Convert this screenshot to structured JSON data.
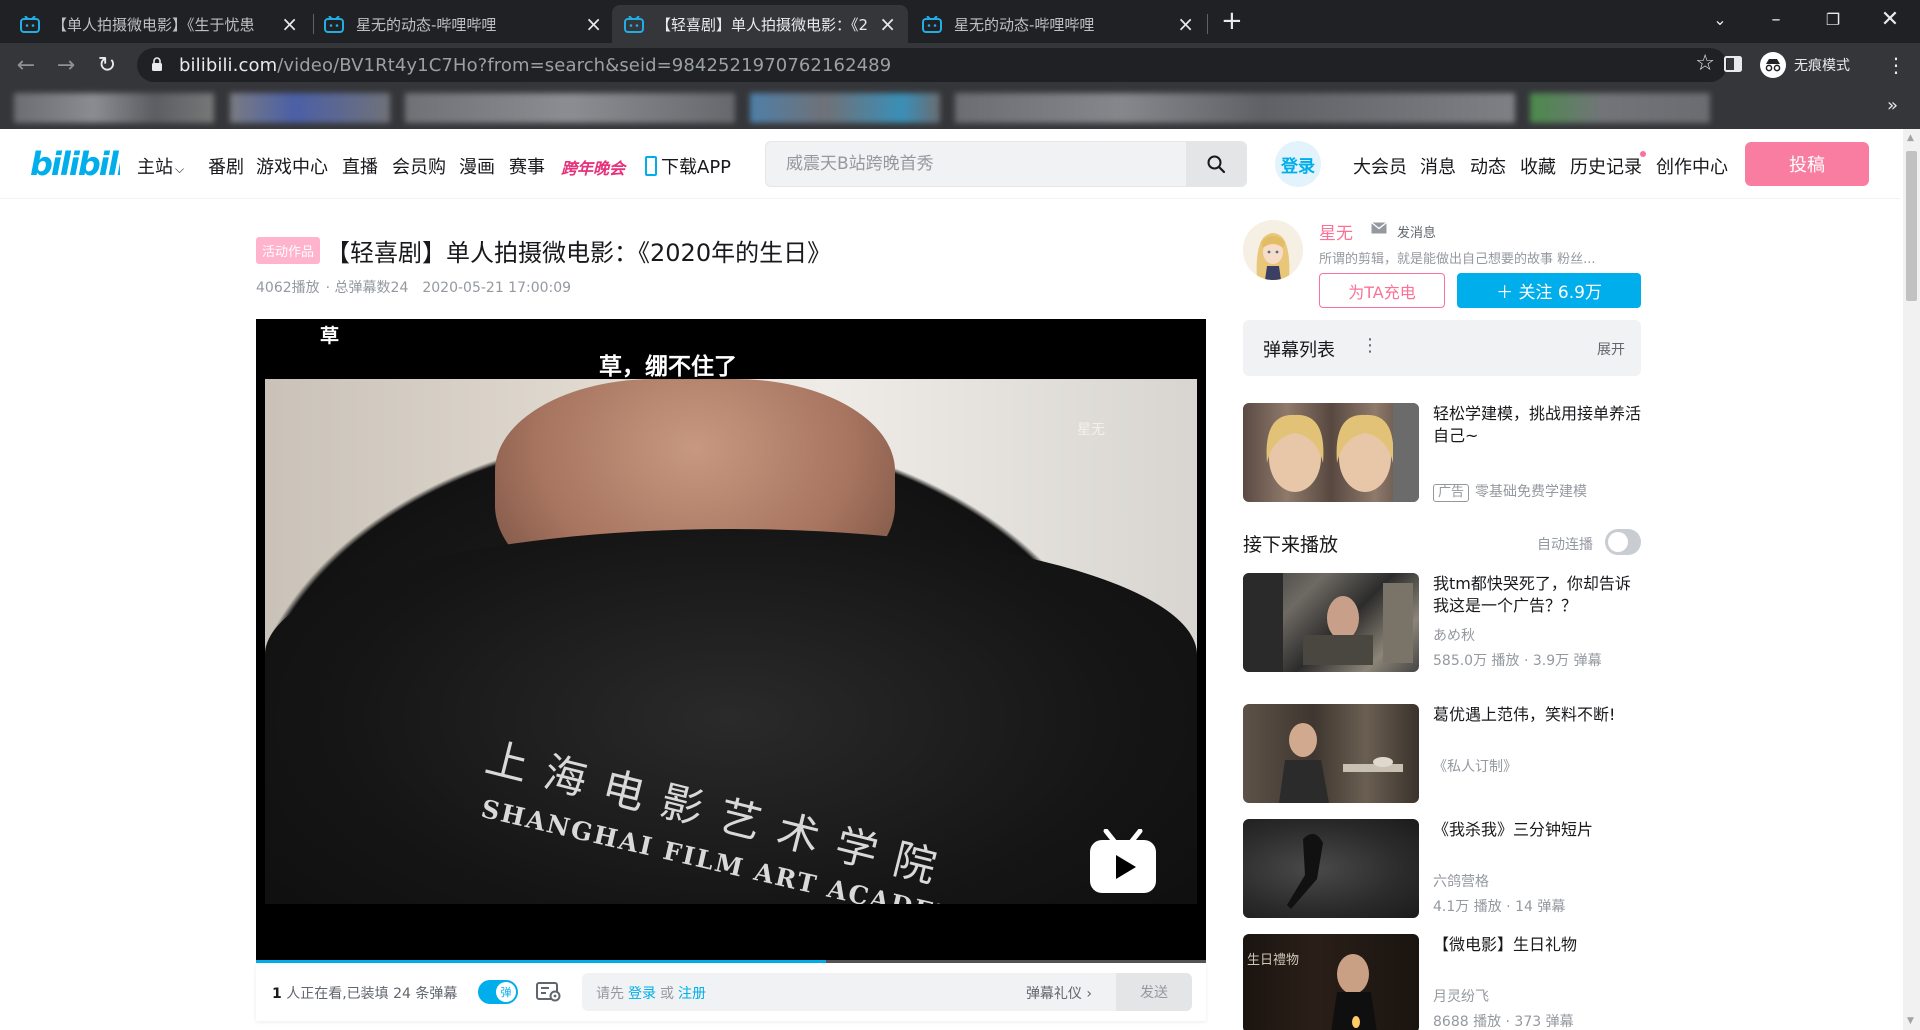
{
  "browser": {
    "tabs": [
      {
        "title": "【单人拍摄微电影】《生于忧患",
        "active": false
      },
      {
        "title": "星无的动态-哔哩哔哩",
        "active": false
      },
      {
        "title": "【轻喜剧】单人拍摄微电影：《2",
        "active": true
      },
      {
        "title": "星无的动态-哔哩哔哩",
        "active": false
      }
    ],
    "url_domain": "bilibili.com",
    "url_path": "/video/BV1Rt4y1C7Ho?from=search&seid=9842521970762162489",
    "incognito_label": "无痕模式"
  },
  "header": {
    "nav": [
      "主站",
      "番剧",
      "游戏中心",
      "直播",
      "会员购",
      "漫画",
      "赛事",
      "跨年晚会",
      "下载APP"
    ],
    "search_placeholder": "威震天B站跨晚首秀",
    "login": "登录",
    "right_nav": [
      "大会员",
      "消息",
      "动态",
      "收藏",
      "历史记录",
      "创作中心"
    ],
    "upload": "投稿"
  },
  "video": {
    "badge": "活动作品",
    "title": "【轻喜剧】单人拍摄微电影：《2020年的生日》",
    "plays": "4062播放",
    "danmaku_total": "· 总弹幕数24",
    "date": "2020-05-21 17:00:09",
    "danmaku_1": "草",
    "danmaku_2": "草，绷不住了",
    "watermark": "星无",
    "shirt_cn": "上海电影艺术学院",
    "shirt_en": "SHANGHAI FILM ART ACADEMY",
    "progress": 0.6
  },
  "sendbar": {
    "viewers_count": "1",
    "viewers_text": " 人正在看,已装填 24 条弹幕",
    "toggle": "弹",
    "hint_prefix": "请先",
    "hint_login": "登录",
    "hint_or": "或",
    "hint_register": "注册",
    "etiquette": "弹幕礼仪 ›",
    "send": "发送"
  },
  "uploader": {
    "name": "星无",
    "send_msg": "发消息",
    "desc": "所谓的剪辑，就是能做出自己想要的故事 粉丝...",
    "charge": "为TA充电",
    "follow": "＋  关注 6.9万"
  },
  "danmaku_list": {
    "title": "弹幕列表",
    "expand": "展开"
  },
  "ad": {
    "title": "轻松学建模，挑战用接单养活自己~",
    "tag": "广告",
    "sub": "零基础免费学建模"
  },
  "up_next": {
    "title": "接下来播放",
    "autoplay": "自动连播"
  },
  "recommendations": [
    {
      "title": "我tm都快哭死了，你却告诉我这是一个广告？？",
      "up": "あめ秋",
      "stats": "585.0万 播放 · 3.9万 弹幕"
    },
    {
      "title": "葛优遇上范伟，笑料不断!",
      "up": "《私人订制》",
      "stats": ""
    },
    {
      "title": "《我杀我》三分钟短片",
      "up": "六鸽营格",
      "stats": "4.1万 播放 · 14 弹幕"
    },
    {
      "title": "【微电影】生日礼物",
      "up": "月灵纷飞",
      "stats": "8688 播放 · 373 弹幕"
    }
  ],
  "colors": {
    "brand_blue": "#00aeec",
    "brand_pink": "#fb7299",
    "upload_pink": "#f87da0"
  }
}
